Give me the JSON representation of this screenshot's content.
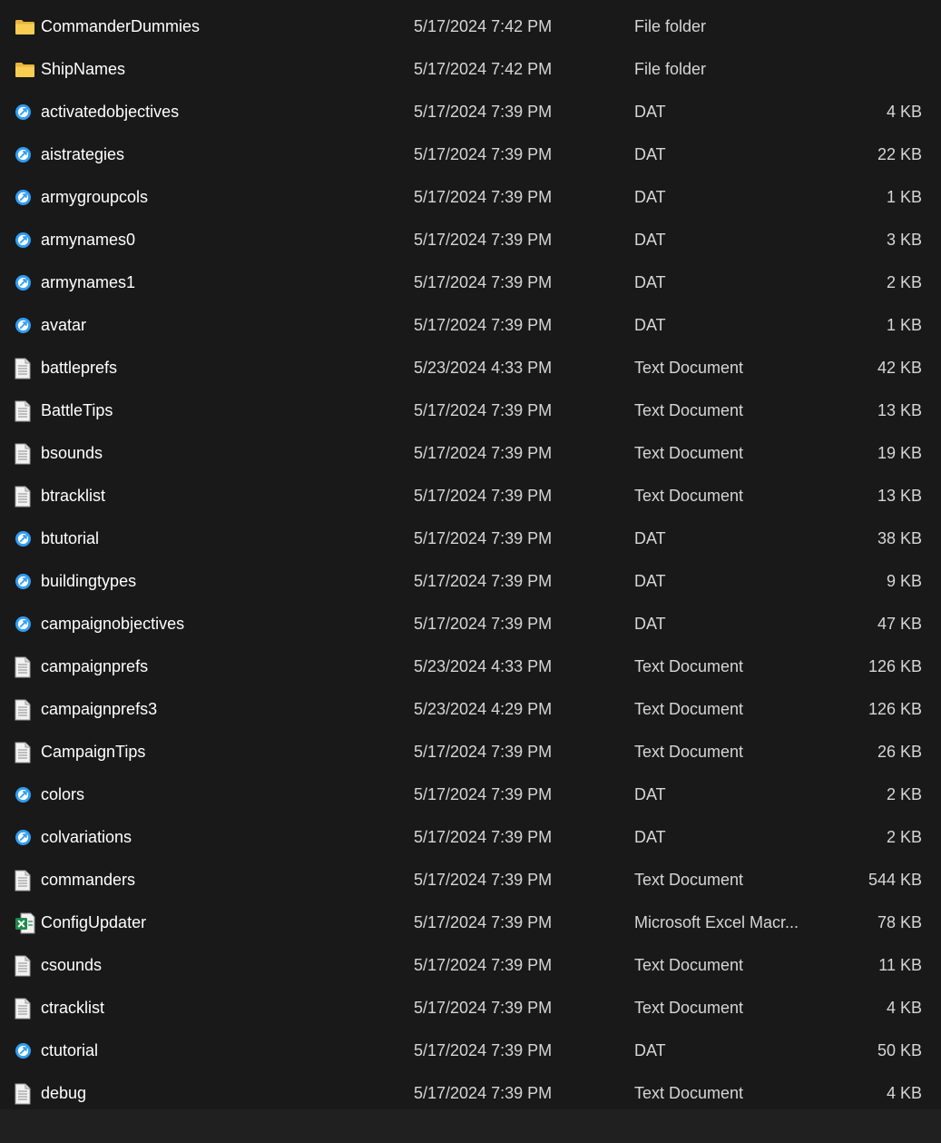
{
  "files": [
    {
      "name": "CommanderDummies",
      "date": "5/17/2024 7:42 PM",
      "type": "File folder",
      "size": "",
      "icon": "folder-icon"
    },
    {
      "name": "ShipNames",
      "date": "5/17/2024 7:42 PM",
      "type": "File folder",
      "size": "",
      "icon": "folder-icon"
    },
    {
      "name": "activatedobjectives",
      "date": "5/17/2024 7:39 PM",
      "type": "DAT",
      "size": "4 KB",
      "icon": "dat-file-icon"
    },
    {
      "name": "aistrategies",
      "date": "5/17/2024 7:39 PM",
      "type": "DAT",
      "size": "22 KB",
      "icon": "dat-file-icon"
    },
    {
      "name": "armygroupcols",
      "date": "5/17/2024 7:39 PM",
      "type": "DAT",
      "size": "1 KB",
      "icon": "dat-file-icon"
    },
    {
      "name": "armynames0",
      "date": "5/17/2024 7:39 PM",
      "type": "DAT",
      "size": "3 KB",
      "icon": "dat-file-icon"
    },
    {
      "name": "armynames1",
      "date": "5/17/2024 7:39 PM",
      "type": "DAT",
      "size": "2 KB",
      "icon": "dat-file-icon"
    },
    {
      "name": "avatar",
      "date": "5/17/2024 7:39 PM",
      "type": "DAT",
      "size": "1 KB",
      "icon": "dat-file-icon"
    },
    {
      "name": "battleprefs",
      "date": "5/23/2024 4:33 PM",
      "type": "Text Document",
      "size": "42 KB",
      "icon": "text-document-icon"
    },
    {
      "name": "BattleTips",
      "date": "5/17/2024 7:39 PM",
      "type": "Text Document",
      "size": "13 KB",
      "icon": "text-document-icon"
    },
    {
      "name": "bsounds",
      "date": "5/17/2024 7:39 PM",
      "type": "Text Document",
      "size": "19 KB",
      "icon": "text-document-icon"
    },
    {
      "name": "btracklist",
      "date": "5/17/2024 7:39 PM",
      "type": "Text Document",
      "size": "13 KB",
      "icon": "text-document-icon"
    },
    {
      "name": "btutorial",
      "date": "5/17/2024 7:39 PM",
      "type": "DAT",
      "size": "38 KB",
      "icon": "dat-file-icon"
    },
    {
      "name": "buildingtypes",
      "date": "5/17/2024 7:39 PM",
      "type": "DAT",
      "size": "9 KB",
      "icon": "dat-file-icon"
    },
    {
      "name": "campaignobjectives",
      "date": "5/17/2024 7:39 PM",
      "type": "DAT",
      "size": "47 KB",
      "icon": "dat-file-icon"
    },
    {
      "name": "campaignprefs",
      "date": "5/23/2024 4:33 PM",
      "type": "Text Document",
      "size": "126 KB",
      "icon": "text-document-icon"
    },
    {
      "name": "campaignprefs3",
      "date": "5/23/2024 4:29 PM",
      "type": "Text Document",
      "size": "126 KB",
      "icon": "text-document-icon"
    },
    {
      "name": "CampaignTips",
      "date": "5/17/2024 7:39 PM",
      "type": "Text Document",
      "size": "26 KB",
      "icon": "text-document-icon"
    },
    {
      "name": "colors",
      "date": "5/17/2024 7:39 PM",
      "type": "DAT",
      "size": "2 KB",
      "icon": "dat-file-icon"
    },
    {
      "name": "colvariations",
      "date": "5/17/2024 7:39 PM",
      "type": "DAT",
      "size": "2 KB",
      "icon": "dat-file-icon"
    },
    {
      "name": "commanders",
      "date": "5/17/2024 7:39 PM",
      "type": "Text Document",
      "size": "544 KB",
      "icon": "text-document-icon"
    },
    {
      "name": "ConfigUpdater",
      "date": "5/17/2024 7:39 PM",
      "type": "Microsoft Excel Macr...",
      "size": "78 KB",
      "icon": "excel-icon"
    },
    {
      "name": "csounds",
      "date": "5/17/2024 7:39 PM",
      "type": "Text Document",
      "size": "11 KB",
      "icon": "text-document-icon"
    },
    {
      "name": "ctracklist",
      "date": "5/17/2024 7:39 PM",
      "type": "Text Document",
      "size": "4 KB",
      "icon": "text-document-icon"
    },
    {
      "name": "ctutorial",
      "date": "5/17/2024 7:39 PM",
      "type": "DAT",
      "size": "50 KB",
      "icon": "dat-file-icon"
    },
    {
      "name": "debug",
      "date": "5/17/2024 7:39 PM",
      "type": "Text Document",
      "size": "4 KB",
      "icon": "text-document-icon"
    }
  ],
  "colors": {
    "background": "#191919",
    "footer_strip": "#202020",
    "primary_text": "#ffffff",
    "secondary_text": "#d6d6d6",
    "folder": "#f4c84b",
    "dat_icon": "#2f9ef4",
    "excel": "#1f8a4c"
  }
}
